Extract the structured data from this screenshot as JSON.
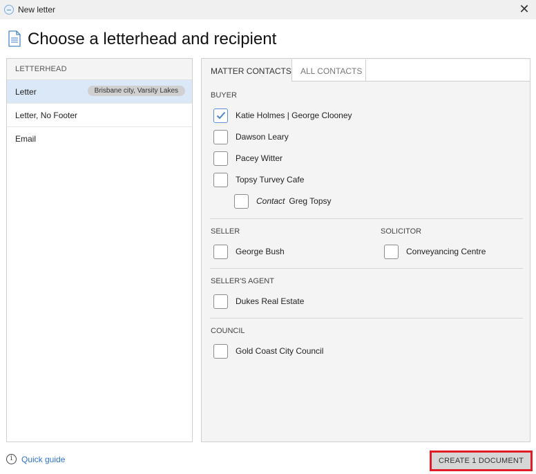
{
  "window": {
    "title": "New letter"
  },
  "page": {
    "title": "Choose a letterhead and recipient"
  },
  "letterhead": {
    "header": "LETTERHEAD",
    "items": [
      {
        "label": "Letter",
        "tag": "Brisbane city, Varsity Lakes",
        "selected": true
      },
      {
        "label": "Letter, No Footer"
      },
      {
        "label": "Email"
      }
    ]
  },
  "contacts": {
    "tabs": [
      {
        "label": "MATTER CONTACTS",
        "active": true
      },
      {
        "label": "ALL CONTACTS",
        "active": false
      }
    ],
    "buyer": {
      "title": "BUYER",
      "items": [
        {
          "label": "Katie Holmes | George Clooney",
          "checked": true
        },
        {
          "label": "Dawson Leary",
          "checked": false
        },
        {
          "label": "Pacey Witter",
          "checked": false
        },
        {
          "label": "Topsy Turvey Cafe",
          "checked": false
        },
        {
          "prefix": "Contact",
          "label": "Greg Topsy",
          "checked": false
        }
      ]
    },
    "seller": {
      "title": "SELLER",
      "items": [
        {
          "label": "George Bush",
          "checked": false
        }
      ]
    },
    "solicitor": {
      "title": "SOLICITOR",
      "items": [
        {
          "label": "Conveyancing Centre",
          "checked": false
        }
      ]
    },
    "sellers_agent": {
      "title": "SELLER'S AGENT",
      "items": [
        {
          "label": "Dukes Real Estate",
          "checked": false
        }
      ]
    },
    "council": {
      "title": "COUNCIL",
      "items": [
        {
          "label": "Gold Coast City Council",
          "checked": false
        }
      ]
    }
  },
  "footer": {
    "quick_guide": "Quick guide",
    "create_button": "CREATE 1 DOCUMENT"
  },
  "colors": {
    "accent": "#2e75c8",
    "selected_bg": "#dbe8f7",
    "highlight_border": "#e01b24"
  }
}
